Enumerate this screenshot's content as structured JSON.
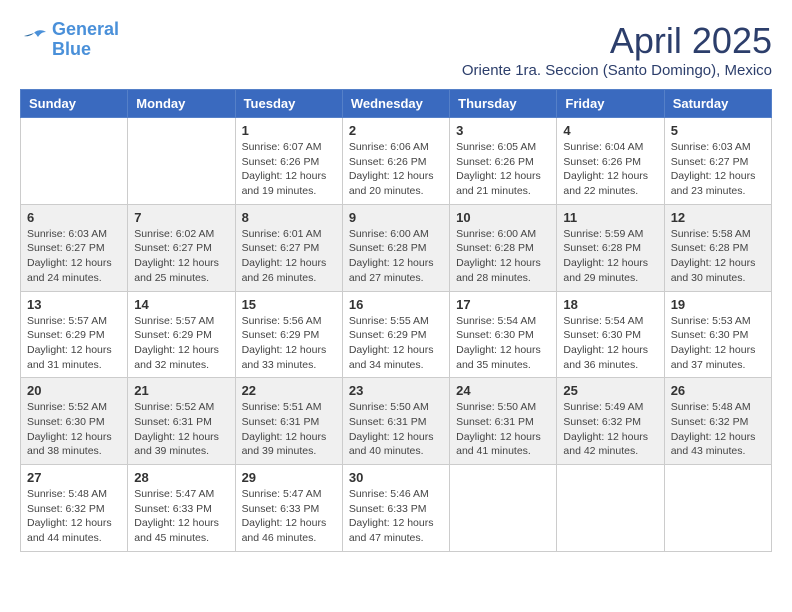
{
  "header": {
    "logo_line1": "General",
    "logo_line2": "Blue",
    "month_year": "April 2025",
    "location": "Oriente 1ra. Seccion (Santo Domingo), Mexico"
  },
  "days_of_week": [
    "Sunday",
    "Monday",
    "Tuesday",
    "Wednesday",
    "Thursday",
    "Friday",
    "Saturday"
  ],
  "weeks": [
    [
      {
        "day": "",
        "info": ""
      },
      {
        "day": "",
        "info": ""
      },
      {
        "day": "1",
        "info": "Sunrise: 6:07 AM\nSunset: 6:26 PM\nDaylight: 12 hours and 19 minutes."
      },
      {
        "day": "2",
        "info": "Sunrise: 6:06 AM\nSunset: 6:26 PM\nDaylight: 12 hours and 20 minutes."
      },
      {
        "day": "3",
        "info": "Sunrise: 6:05 AM\nSunset: 6:26 PM\nDaylight: 12 hours and 21 minutes."
      },
      {
        "day": "4",
        "info": "Sunrise: 6:04 AM\nSunset: 6:26 PM\nDaylight: 12 hours and 22 minutes."
      },
      {
        "day": "5",
        "info": "Sunrise: 6:03 AM\nSunset: 6:27 PM\nDaylight: 12 hours and 23 minutes."
      }
    ],
    [
      {
        "day": "6",
        "info": "Sunrise: 6:03 AM\nSunset: 6:27 PM\nDaylight: 12 hours and 24 minutes."
      },
      {
        "day": "7",
        "info": "Sunrise: 6:02 AM\nSunset: 6:27 PM\nDaylight: 12 hours and 25 minutes."
      },
      {
        "day": "8",
        "info": "Sunrise: 6:01 AM\nSunset: 6:27 PM\nDaylight: 12 hours and 26 minutes."
      },
      {
        "day": "9",
        "info": "Sunrise: 6:00 AM\nSunset: 6:28 PM\nDaylight: 12 hours and 27 minutes."
      },
      {
        "day": "10",
        "info": "Sunrise: 6:00 AM\nSunset: 6:28 PM\nDaylight: 12 hours and 28 minutes."
      },
      {
        "day": "11",
        "info": "Sunrise: 5:59 AM\nSunset: 6:28 PM\nDaylight: 12 hours and 29 minutes."
      },
      {
        "day": "12",
        "info": "Sunrise: 5:58 AM\nSunset: 6:28 PM\nDaylight: 12 hours and 30 minutes."
      }
    ],
    [
      {
        "day": "13",
        "info": "Sunrise: 5:57 AM\nSunset: 6:29 PM\nDaylight: 12 hours and 31 minutes."
      },
      {
        "day": "14",
        "info": "Sunrise: 5:57 AM\nSunset: 6:29 PM\nDaylight: 12 hours and 32 minutes."
      },
      {
        "day": "15",
        "info": "Sunrise: 5:56 AM\nSunset: 6:29 PM\nDaylight: 12 hours and 33 minutes."
      },
      {
        "day": "16",
        "info": "Sunrise: 5:55 AM\nSunset: 6:29 PM\nDaylight: 12 hours and 34 minutes."
      },
      {
        "day": "17",
        "info": "Sunrise: 5:54 AM\nSunset: 6:30 PM\nDaylight: 12 hours and 35 minutes."
      },
      {
        "day": "18",
        "info": "Sunrise: 5:54 AM\nSunset: 6:30 PM\nDaylight: 12 hours and 36 minutes."
      },
      {
        "day": "19",
        "info": "Sunrise: 5:53 AM\nSunset: 6:30 PM\nDaylight: 12 hours and 37 minutes."
      }
    ],
    [
      {
        "day": "20",
        "info": "Sunrise: 5:52 AM\nSunset: 6:30 PM\nDaylight: 12 hours and 38 minutes."
      },
      {
        "day": "21",
        "info": "Sunrise: 5:52 AM\nSunset: 6:31 PM\nDaylight: 12 hours and 39 minutes."
      },
      {
        "day": "22",
        "info": "Sunrise: 5:51 AM\nSunset: 6:31 PM\nDaylight: 12 hours and 39 minutes."
      },
      {
        "day": "23",
        "info": "Sunrise: 5:50 AM\nSunset: 6:31 PM\nDaylight: 12 hours and 40 minutes."
      },
      {
        "day": "24",
        "info": "Sunrise: 5:50 AM\nSunset: 6:31 PM\nDaylight: 12 hours and 41 minutes."
      },
      {
        "day": "25",
        "info": "Sunrise: 5:49 AM\nSunset: 6:32 PM\nDaylight: 12 hours and 42 minutes."
      },
      {
        "day": "26",
        "info": "Sunrise: 5:48 AM\nSunset: 6:32 PM\nDaylight: 12 hours and 43 minutes."
      }
    ],
    [
      {
        "day": "27",
        "info": "Sunrise: 5:48 AM\nSunset: 6:32 PM\nDaylight: 12 hours and 44 minutes."
      },
      {
        "day": "28",
        "info": "Sunrise: 5:47 AM\nSunset: 6:33 PM\nDaylight: 12 hours and 45 minutes."
      },
      {
        "day": "29",
        "info": "Sunrise: 5:47 AM\nSunset: 6:33 PM\nDaylight: 12 hours and 46 minutes."
      },
      {
        "day": "30",
        "info": "Sunrise: 5:46 AM\nSunset: 6:33 PM\nDaylight: 12 hours and 47 minutes."
      },
      {
        "day": "",
        "info": ""
      },
      {
        "day": "",
        "info": ""
      },
      {
        "day": "",
        "info": ""
      }
    ]
  ]
}
